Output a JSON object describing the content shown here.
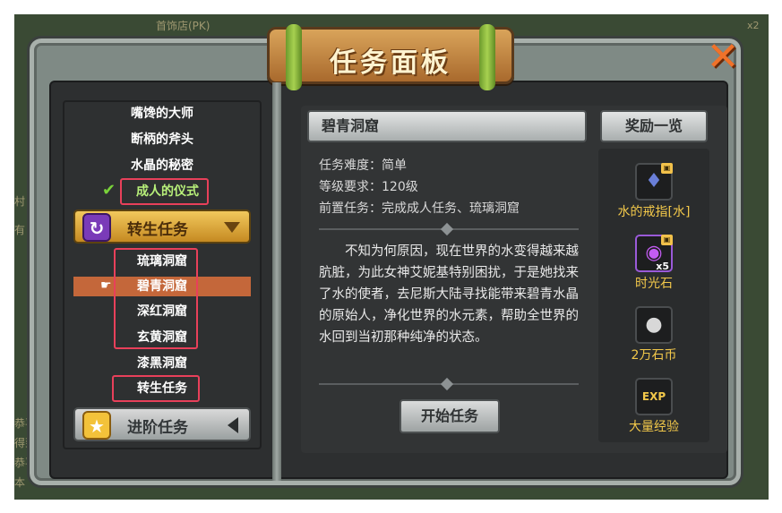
{
  "background": {
    "chat_top": "首饰店(PK)",
    "chat_left": [
      "村",
      "有",
      "恭喜",
      "得到",
      "恭喜",
      "本"
    ],
    "badge": "x2"
  },
  "window": {
    "title": "任务面板",
    "close_icon": "close-x-icon",
    "accent": "#f0722a"
  },
  "quest_list": {
    "completed_items": [
      "嘴馋的大师",
      "断柄的斧头",
      "水晶的秘密"
    ],
    "done_item": "成人的仪式",
    "rebirth_category": "转生任务",
    "rebirth_items": [
      "琉璃洞窟",
      "碧青洞窟",
      "深红洞窟",
      "玄黄洞窟"
    ],
    "after_items": [
      "漆黑洞窟",
      "转生任务"
    ],
    "advance_category": "进阶任务",
    "selected_index": 1
  },
  "detail": {
    "title": "碧青洞窟",
    "difficulty": "任务难度：简单",
    "level": "等级要求：120级",
    "prereq": "前置任务：完成成人任务、琉璃洞窟",
    "description": "不知为何原因，现在世界的水变得越来越肮脏，为此女神艾妮基特别困扰，于是她找来了水的使者，去尼斯大陆寻找能带来碧青水晶的原始人，净化世界的水元素，帮助全世界的水回到当初那种纯净的状态。",
    "start_button": "开始任务"
  },
  "rewards": {
    "header": "奖励一览",
    "items": [
      {
        "name": "水的戒指[水]",
        "icon": "ring-icon",
        "glyph": "♦",
        "qty": "",
        "locked": true
      },
      {
        "name": "时光石",
        "icon": "purple-stone-icon",
        "glyph": "◉",
        "qty": "x5",
        "locked": true
      },
      {
        "name": "2万石币",
        "icon": "stone-coin-icon",
        "glyph": "●",
        "qty": "",
        "locked": false
      },
      {
        "name": "大量经验",
        "icon": "exp-icon",
        "glyph": "EXP",
        "qty": "",
        "locked": false
      }
    ]
  }
}
